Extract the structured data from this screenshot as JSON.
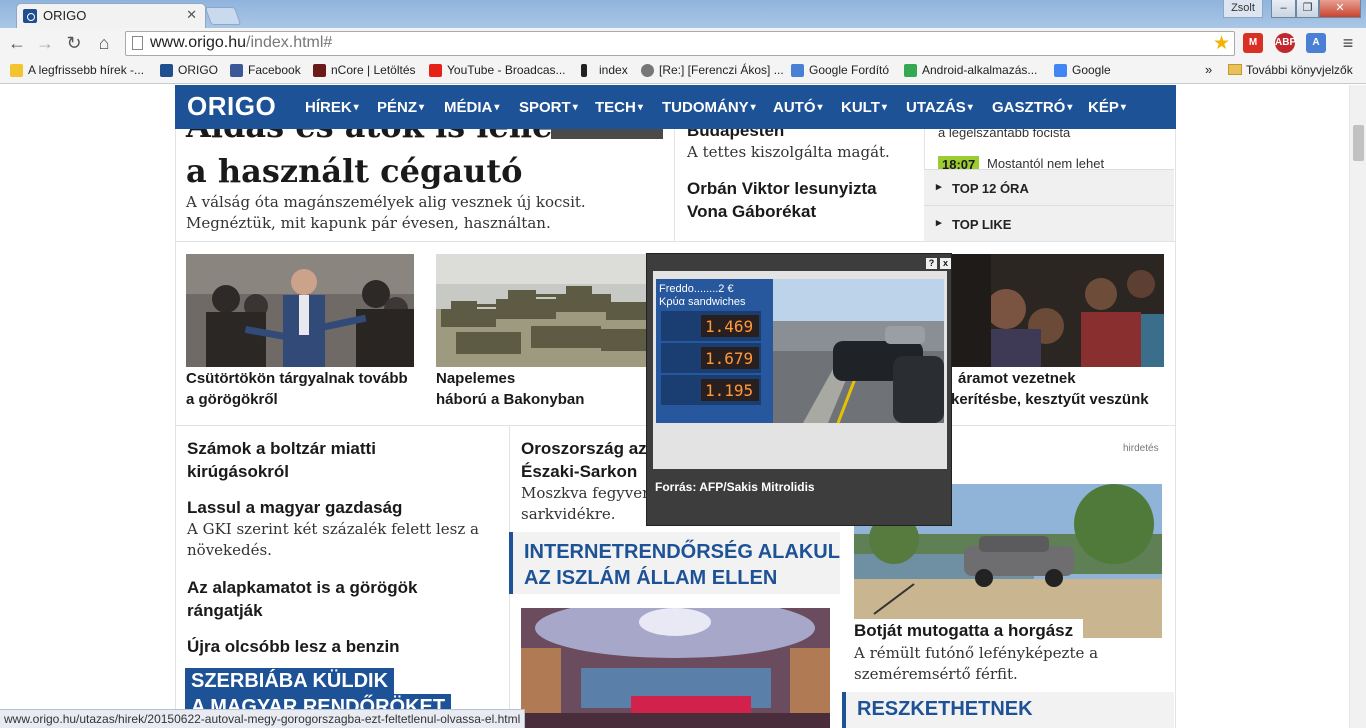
{
  "browser": {
    "tab_title": "ORIGO",
    "user_name": "Zsolt",
    "url_host": "www.origo.hu",
    "url_path": "/index.html#",
    "bookmarks": [
      "A legfrissebb hírek -...",
      "ORIGO",
      "Facebook",
      "nCore | Letöltés",
      "YouTube - Broadcas...",
      "index",
      "[Re:] [Ferenczi Ákos] ...",
      "Google Fordító",
      "Android-alkalmazás...",
      "Google"
    ],
    "bookmarks_more": "»",
    "other_bookmarks": "További könyvjelzők",
    "status_url": "www.origo.hu/utazas/hirek/20150622-autoval-megy-gorogorszagba-ezt-feltetlenul-olvassa-el.html"
  },
  "site": {
    "logo": "ORIGO",
    "nav": [
      "HÍREK",
      "PÉNZ",
      "MÉDIA",
      "SPORT",
      "TECH",
      "TUDOMÁNY",
      "AUTÓ",
      "KULT",
      "UTAZÁS",
      "GASZTRÓ",
      "KÉP"
    ]
  },
  "top": {
    "main_title_line1": "Áldás és átok is lehet",
    "main_title_line2": "a használt cégautó",
    "main_lead_line1": "A válság óta magánszemélyek alig vesznek új kocsit.",
    "main_lead_line2": "Megnéztük, mit kapunk pár évesen, használtan.",
    "mid_title_partial": "Budapesten",
    "mid_lead": "A tettes kiszolgálta magát.",
    "mid_title2_line1": "Orbán Viktor lesunyizta",
    "mid_title2_line2": "Vona Gáborékat",
    "side_partial": "a legelszántabb focista",
    "side_time": "18:07",
    "side_time_text": "Mostantól nem lehet",
    "side_box1": "TOP 12 ÓRA",
    "side_box2": "TOP LIKE"
  },
  "photo_row": [
    {
      "line1": "Csütörtökön tárgyalnak tovább",
      "line2": "a görögökről"
    },
    {
      "line1": "Napelemes",
      "line2": "háború a Bakonyban"
    },
    {
      "line1": "áramot vezetnek",
      "line2": "kerítésbe, kesztyűt veszünk"
    }
  ],
  "left_col": {
    "item1_line1": "Számok a boltzár miatti",
    "item1_line2": "kirúgásokról",
    "item2_title": "Lassul a magyar gazdaság",
    "item2_lead_line1": "A GKI szerint két százalék felett lesz a",
    "item2_lead_line2": "növekedés.",
    "item3_line1": "Az alapkamatot is a görögök",
    "item3_line2": "rángatják",
    "item4": "Újra olcsóbb lesz a benzin",
    "kicker_line1": "SZERBIÁBA KÜLDIK",
    "kicker_line2": "A MAGYAR RENDŐRÖKET"
  },
  "mid_col": {
    "title_line1": "Oroszország az",
    "title_line2": "Északi-Sarkon",
    "lead_line1": "Moszkva fegyvere",
    "lead_line2": "sarkvidékre.",
    "highlight_line1": "INTERNETRENDŐRSÉG ALAKUL",
    "highlight_line2": "AZ ISZLÁM ÁLLAM ELLEN"
  },
  "right_col": {
    "ad_label": "hirdetés",
    "title": "Botját mutogatta a horgász",
    "lead_line1": "A rémült futónő lefényképezte a",
    "lead_line2": "szeméremsértő férfit.",
    "highlight_partial": "RESZKETHETNEK"
  },
  "popup": {
    "sign_line1": "Freddo........2 €",
    "sign_line2": "Κρύα sandwiches",
    "prices": [
      "1.469",
      "1.679",
      "1.195"
    ],
    "caption": "Forrás: AFP/Sakis Mitrolidis",
    "help": "?",
    "close": "x"
  }
}
